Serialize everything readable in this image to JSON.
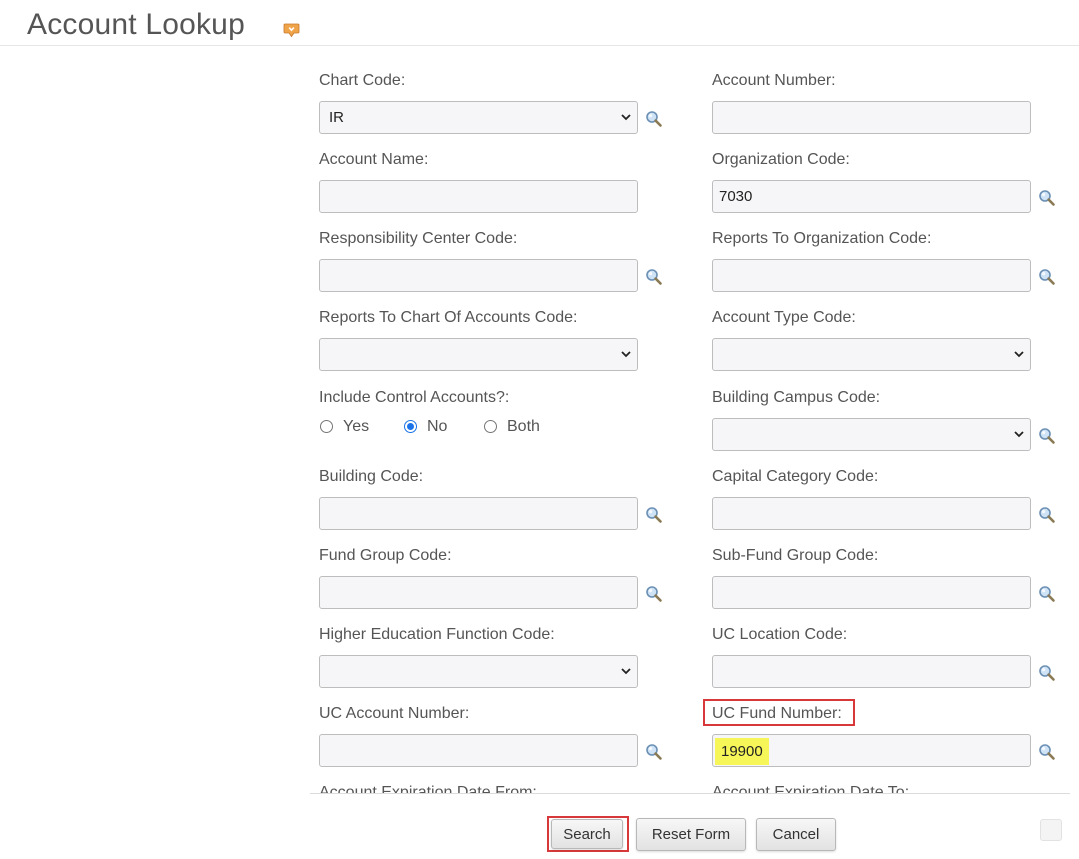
{
  "header": {
    "title": "Account Lookup",
    "help_icon": "help-bubble-icon"
  },
  "form": {
    "chart_code": {
      "label": "Chart Code:",
      "value": "IR"
    },
    "account_number": {
      "label": "Account Number:",
      "value": ""
    },
    "account_name": {
      "label": "Account Name:",
      "value": ""
    },
    "organization_code": {
      "label": "Organization Code:",
      "value": "7030"
    },
    "responsibility_center_code": {
      "label": "Responsibility Center Code:",
      "value": ""
    },
    "reports_to_org_code": {
      "label": "Reports To Organization Code:",
      "value": ""
    },
    "reports_to_chart_code": {
      "label": "Reports To Chart Of Accounts Code:",
      "value": ""
    },
    "account_type_code": {
      "label": "Account Type Code:",
      "value": ""
    },
    "include_control_accounts": {
      "label": "Include Control Accounts?:",
      "options": [
        "Yes",
        "No",
        "Both"
      ],
      "selected": "No"
    },
    "building_campus_code": {
      "label": "Building Campus Code:",
      "value": ""
    },
    "building_code": {
      "label": "Building Code:",
      "value": ""
    },
    "capital_category_code": {
      "label": "Capital Category Code:",
      "value": ""
    },
    "fund_group_code": {
      "label": "Fund Group Code:",
      "value": ""
    },
    "sub_fund_group_code": {
      "label": "Sub-Fund Group Code:",
      "value": ""
    },
    "higher_ed_function_code": {
      "label": "Higher Education Function Code:",
      "value": ""
    },
    "uc_location_code": {
      "label": "UC Location Code:",
      "value": ""
    },
    "uc_account_number": {
      "label": "UC Account Number:",
      "value": ""
    },
    "uc_fund_number": {
      "label": "UC Fund Number:",
      "value": "19900"
    },
    "expiration_date_from": {
      "label": "Account Expiration Date From:"
    },
    "expiration_date_to": {
      "label": "Account Expiration Date To:"
    }
  },
  "buttons": {
    "search": "Search",
    "reset": "Reset Form",
    "cancel": "Cancel"
  },
  "colors": {
    "annotation_red": "#d9383a",
    "highlight_yellow": "#f6f659",
    "radio_blue": "#1a73e8"
  }
}
